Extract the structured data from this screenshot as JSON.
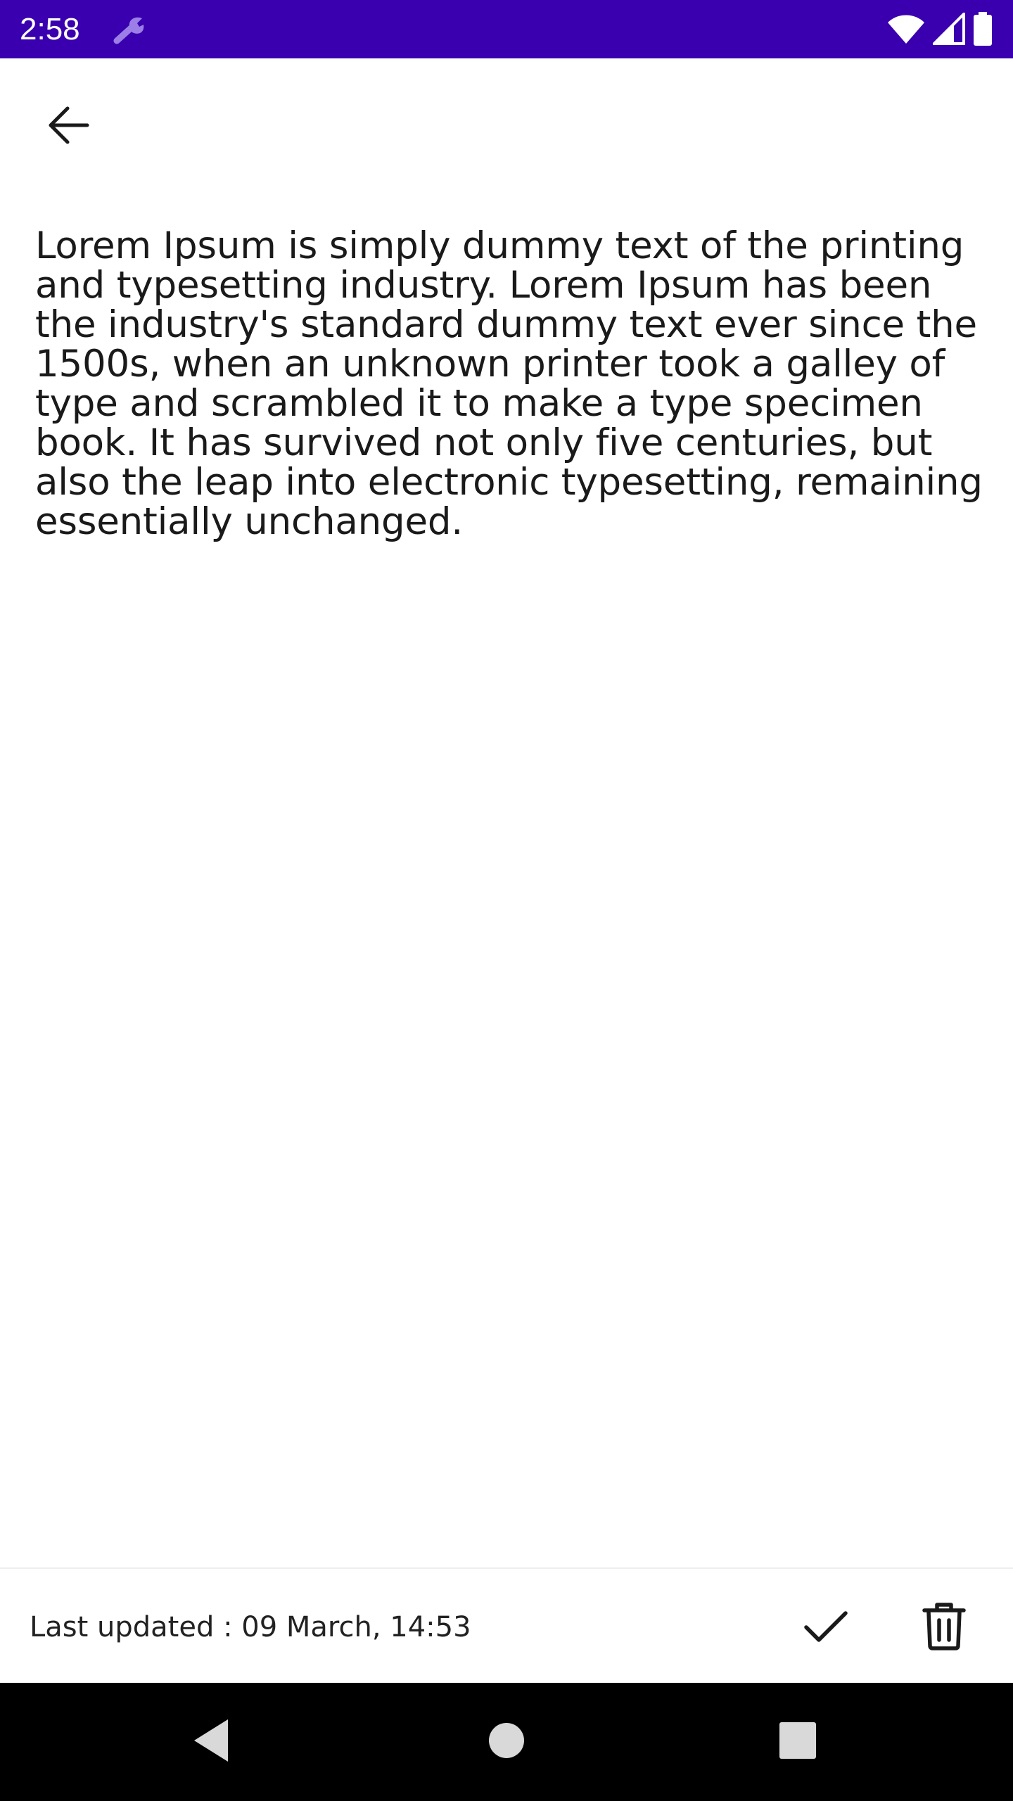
{
  "status_bar": {
    "time": "2:58",
    "background_color": "#3a00b0",
    "icons": [
      "wrench-icon",
      "wifi-icon",
      "signal-icon",
      "battery-icon"
    ]
  },
  "toolbar": {
    "back_icon": "arrow-left-icon"
  },
  "note": {
    "body": "Lorem Ipsum is simply dummy text of the printing and typesetting industry. Lorem Ipsum has been the industry's standard dummy text ever since the 1500s, when an unknown printer took a galley of type and scrambled it to make a type specimen book. It has survived not only five centuries, but also the leap into electronic typesetting, remaining essentially unchanged."
  },
  "footer": {
    "last_updated": "Last updated : 09 March, 14:53",
    "save_icon": "check-icon",
    "delete_icon": "trash-icon"
  },
  "navigation_bar": {
    "icons": [
      "nav-back-icon",
      "nav-home-icon",
      "nav-recents-icon"
    ]
  }
}
